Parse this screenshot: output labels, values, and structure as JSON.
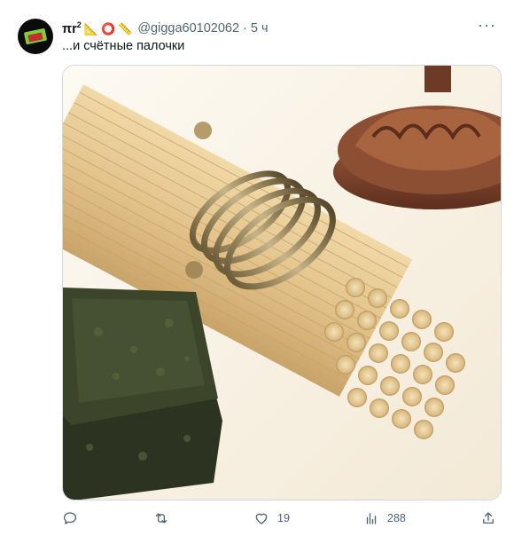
{
  "tweet": {
    "display_name": "πr",
    "name_superscript": "2",
    "emojis": [
      "📐",
      "⭕",
      "📏"
    ],
    "handle": "@gigga60102062",
    "separator": "·",
    "time": "5 ч",
    "more": "···",
    "text": "...и счётные палочки"
  },
  "actions": {
    "reply_count": "",
    "retweet_count": "",
    "like_count": "19",
    "views_count": "288"
  },
  "colors": {
    "secondary_text": "#536471",
    "border": "#cfd9de"
  }
}
